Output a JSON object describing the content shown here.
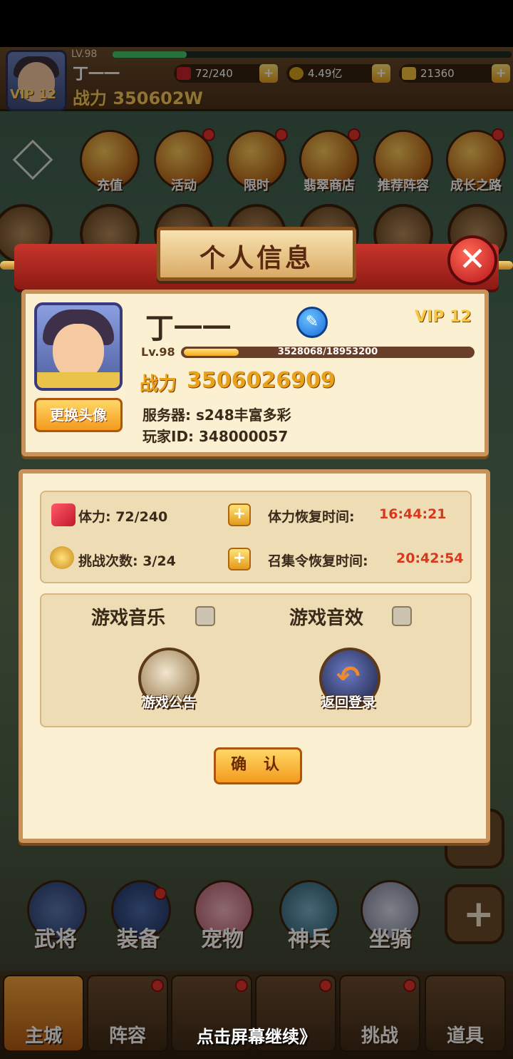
{
  "hud": {
    "level": "LV.98",
    "name": "丁一一",
    "power": "战力 350602W",
    "vip": "VIP 12",
    "stamina": "72/240",
    "coins": "4.49亿",
    "gold": "21360"
  },
  "menu_top": [
    "充值",
    "活动",
    "限时",
    "翡翠商店",
    "推荐阵容",
    "成长之路"
  ],
  "dialog": {
    "title": "个人信息",
    "player_name": "丁一一",
    "vip": "VIP 12",
    "level": "Lv.98",
    "exp": "3528068/18953200",
    "power_label": "战力",
    "power_value": "3506026909",
    "change_avatar": "更换头像",
    "server": "服务器: s248丰富多彩",
    "player_id": "玩家ID: 348000057",
    "stamina": "体力: 72/240",
    "challenges": "挑战次数: 3/24",
    "stamina_recover_label": "体力恢复时间:",
    "stamina_recover_time": "16:44:21",
    "summon_recover_label": "召集令恢复时间:",
    "summon_recover_time": "20:42:54",
    "music_label": "游戏音乐",
    "sfx_label": "游戏音效",
    "notice_label": "游戏公告",
    "logout_label": "返回登录",
    "confirm": "确 认"
  },
  "features": [
    "武将",
    "装备",
    "宠物",
    "神兵",
    "坐骑"
  ],
  "bottom_nav": [
    "主城",
    "阵容",
    "挑战",
    "道具"
  ],
  "continue_text": "点击屏幕继续》"
}
